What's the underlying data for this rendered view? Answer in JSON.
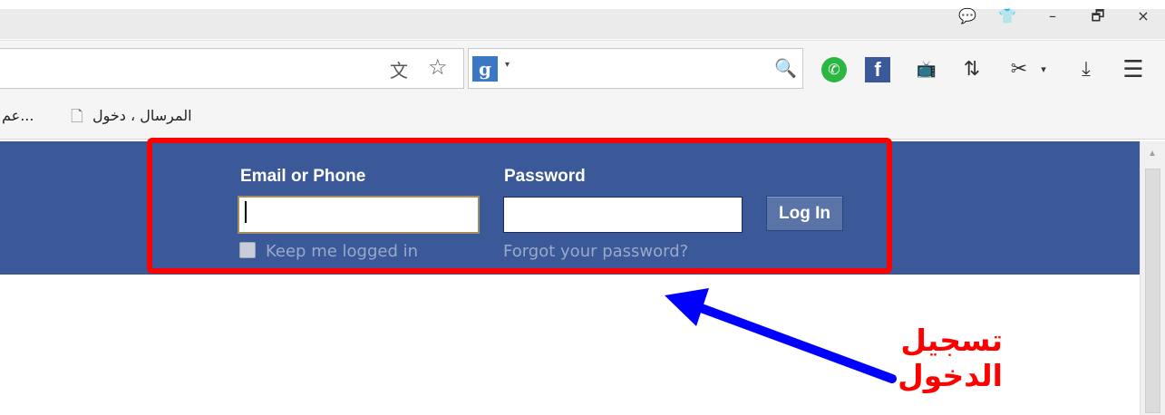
{
  "window": {
    "buttons": [
      "💬",
      "👕",
      "–",
      "🗗",
      "×"
    ]
  },
  "searchbar": {
    "engine_letter": "g",
    "dropdown": "▾",
    "magnifier": "🔍"
  },
  "toolbar": {
    "icons": [
      "whatsapp-icon",
      "facebook-icon",
      "tv-download-icon",
      "transfer-icon",
      "scissors-icon",
      "download-icon",
      "menu-icon"
    ],
    "facebook_glyph": "f",
    "whatsapp_glyph": "✆",
    "tv_glyph": "📺",
    "transfer_glyph": "⇅",
    "scissors_glyph": "✂",
    "scissors_drop": "▾",
    "download_glyph": "⤓",
    "menu_glyph": "☰"
  },
  "urlbar": {
    "translate_glyph": "文",
    "star_glyph": "☆"
  },
  "bookmarks": {
    "items": [
      {
        "label": "المرسال ، دخول"
      },
      {
        "label": "...عم"
      }
    ]
  },
  "login": {
    "email_label": "Email or Phone",
    "password_label": "Password",
    "email_value": "",
    "password_value": "",
    "button_label": "Log In",
    "keep_logged_in": "Keep me logged in",
    "forgot_password": "Forgot your password?"
  },
  "annotation": {
    "line1": "تسجيل",
    "line2": "الدخول",
    "color": "#ff0000",
    "arrow_color": "#0000ff"
  },
  "colors": {
    "facebook_blue": "#3b5998",
    "highlight_red": "#ff0000"
  }
}
